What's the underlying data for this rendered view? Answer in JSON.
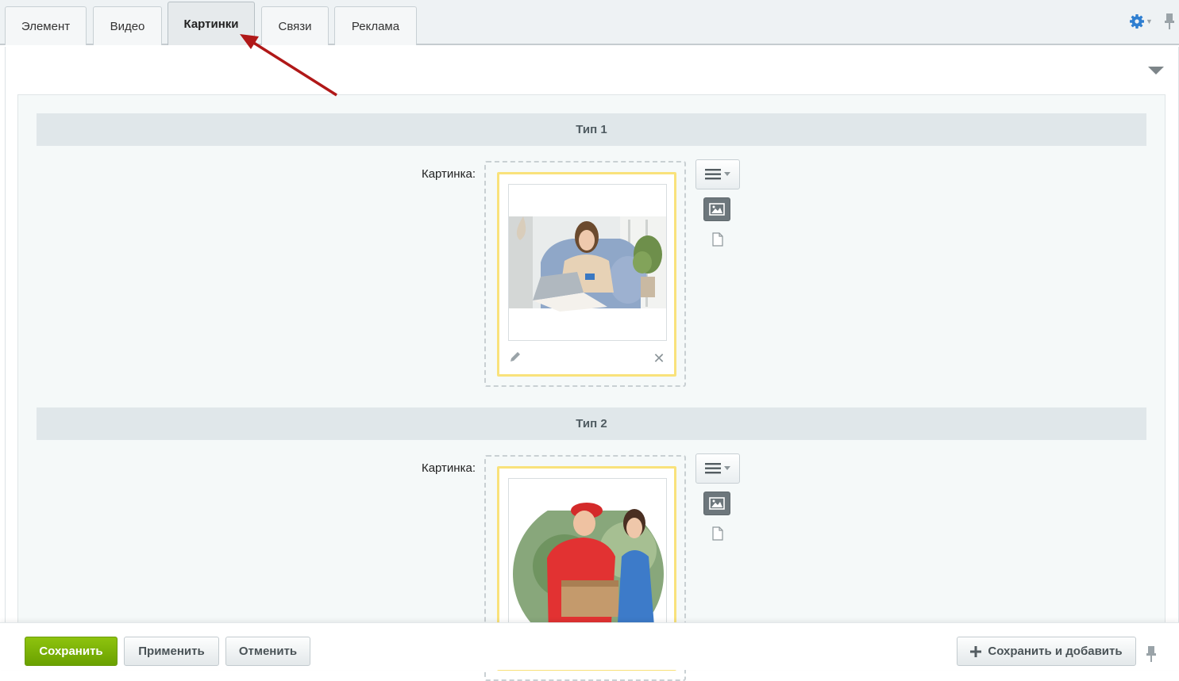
{
  "tabs": [
    {
      "label": "Элемент",
      "active": false
    },
    {
      "label": "Видео",
      "active": false
    },
    {
      "label": "Картинки",
      "active": true
    },
    {
      "label": "Связи",
      "active": false
    },
    {
      "label": "Реклама",
      "active": false
    }
  ],
  "toolbar": {
    "settings_icon": "gear-icon",
    "pin_icon": "pin-icon"
  },
  "sections": [
    {
      "title": "Тип 1",
      "field_label": "Картинка:",
      "image_icon": "woman-with-laptop-photo"
    },
    {
      "title": "Тип 2",
      "field_label": "Картинка:",
      "image_icon": "courier-delivery-photo"
    }
  ],
  "footer": {
    "save_label": "Сохранить",
    "apply_label": "Применить",
    "cancel_label": "Отменить",
    "save_add_label": "Сохранить и добавить"
  },
  "colors": {
    "accent_green": "#7cb30a",
    "arrow": "#b01818",
    "frame_yellow": "#f9e27b",
    "gear_blue": "#2f7fd1"
  }
}
